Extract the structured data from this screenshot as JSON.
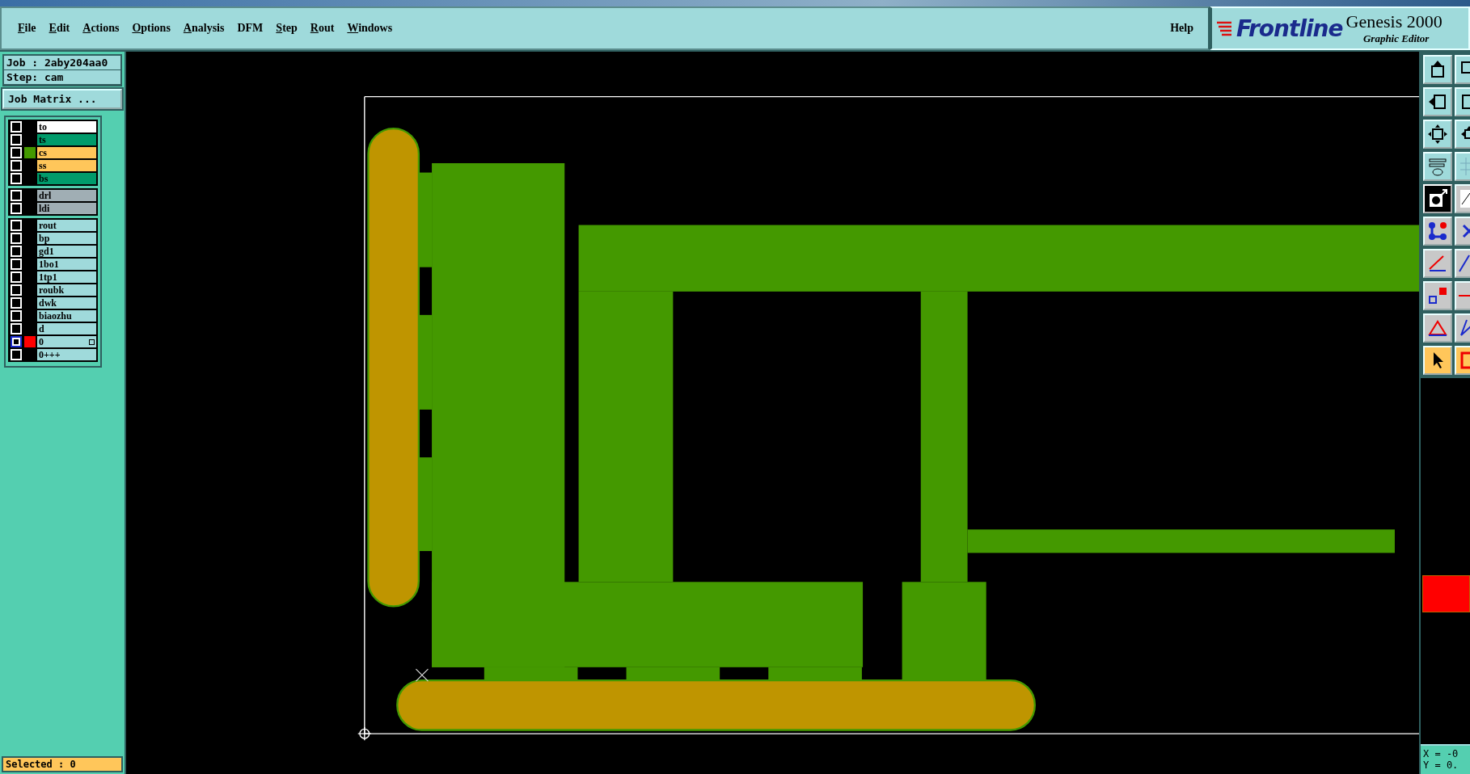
{
  "menu": [
    {
      "label": "File",
      "mnemonic": true
    },
    {
      "label": "Edit",
      "mnemonic": true
    },
    {
      "label": "Actions",
      "mnemonic": true
    },
    {
      "label": "Options",
      "mnemonic": true
    },
    {
      "label": "Analysis",
      "mnemonic": true
    },
    {
      "label": "DFM",
      "mnemonic": false
    },
    {
      "label": "Step",
      "mnemonic": true
    },
    {
      "label": "Rout",
      "mnemonic": true
    },
    {
      "label": "Windows",
      "mnemonic": true
    }
  ],
  "help": {
    "label": "Help",
    "mnemonic": false
  },
  "logo": {
    "brand": "Frontline",
    "product": "Genesis 2000 ",
    "subtitle": "Graphic Editor"
  },
  "job": {
    "job": "Job : 2aby204aa0",
    "step": "Step: cam",
    "matrix_button": "Job Matrix ..."
  },
  "layer_groups": [
    {
      "layers": [
        {
          "name": "to",
          "color": "#ffffff",
          "displayed": false,
          "work_layer": false
        },
        {
          "name": "ts",
          "color": "#009b6b",
          "displayed": false,
          "work_layer": false
        },
        {
          "name": "cs",
          "color": "#ffc65a",
          "displayed": true,
          "work_layer": false
        },
        {
          "name": "ss",
          "color": "#ffc65a",
          "displayed": false,
          "work_layer": false
        },
        {
          "name": "bs",
          "color": "#009b6b",
          "displayed": false,
          "work_layer": false
        }
      ]
    },
    {
      "layers": [
        {
          "name": "drl",
          "color": "#a0aeb4",
          "displayed": false,
          "work_layer": false
        },
        {
          "name": "ldi",
          "color": "#a0aeb4",
          "displayed": false,
          "work_layer": false
        }
      ]
    },
    {
      "layers": [
        {
          "name": "rout",
          "color": "#9fdadb",
          "displayed": false,
          "work_layer": false
        },
        {
          "name": "bp",
          "color": "#9fdadb",
          "displayed": false,
          "work_layer": false
        },
        {
          "name": "gd1",
          "color": "#9fdadb",
          "displayed": false,
          "work_layer": false
        },
        {
          "name": "1bo1",
          "color": "#9fdadb",
          "displayed": false,
          "work_layer": false
        },
        {
          "name": "1tp1",
          "color": "#9fdadb",
          "displayed": false,
          "work_layer": false
        },
        {
          "name": "roubk",
          "color": "#9fdadb",
          "displayed": false,
          "work_layer": false
        },
        {
          "name": "dwk",
          "color": "#9fdadb",
          "displayed": false,
          "work_layer": false
        },
        {
          "name": "biaozhu",
          "color": "#9fdadb",
          "displayed": false,
          "work_layer": false
        },
        {
          "name": "d",
          "color": "#9fdadb",
          "displayed": false,
          "work_layer": false
        },
        {
          "name": "0",
          "color": "#9fdadb",
          "displayed": true,
          "work_layer": true
        },
        {
          "name": "0+++",
          "color": "#9fdadb",
          "displayed": false,
          "work_layer": false
        }
      ]
    }
  ],
  "selected_status": "Selected : 0",
  "tools": [
    {
      "kind": "up",
      "selected": false
    },
    {
      "kind": "down",
      "selected": false
    },
    {
      "kind": "left",
      "selected": false
    },
    {
      "kind": "frame",
      "selected": false
    },
    {
      "kind": "fit",
      "selected": false
    },
    {
      "kind": "pan",
      "selected": false
    },
    {
      "kind": "settings",
      "selected": false
    },
    {
      "kind": "grid",
      "selected": false
    },
    {
      "kind": "snap",
      "selected": true
    },
    {
      "kind": "ruler",
      "selected": false
    },
    {
      "kind": "pads",
      "selected": false
    },
    {
      "kind": "cross",
      "selected": false
    },
    {
      "kind": "angle",
      "selected": false
    },
    {
      "kind": "line",
      "selected": false
    },
    {
      "kind": "offset",
      "selected": false
    },
    {
      "kind": "dash",
      "selected": false
    },
    {
      "kind": "triangle",
      "selected": false
    },
    {
      "kind": "slope",
      "selected": false
    },
    {
      "kind": "pointer",
      "selected": false
    },
    {
      "kind": "box",
      "selected": false
    }
  ],
  "coordinates": {
    "x": "X = -0",
    "y": "Y = 0."
  }
}
